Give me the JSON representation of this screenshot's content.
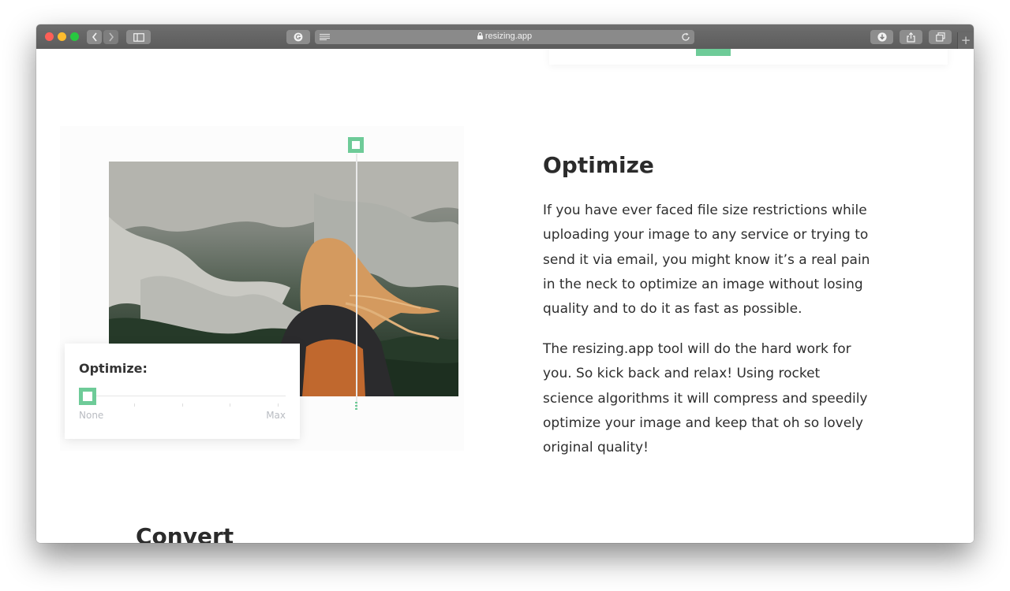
{
  "browser": {
    "url": "resizing.app"
  },
  "illustration": {
    "panel_label": "Optimize:",
    "slider": {
      "min_label": "None",
      "max_label": "Max",
      "value_fraction": 0
    }
  },
  "section": {
    "title": "Optimize",
    "paragraphs": [
      "If you have ever faced file size restrictions while uploading your image to any service or trying to send it via email, you might know it’s a real pain in the neck to optimize an image without losing quality and to do it as fast as possible.",
      "The resizing.app tool will do the hard work for you. So kick back and relax! Using rocket science algorithms it will compress and speedily optimize your image and keep that oh so lovely original quality!"
    ]
  },
  "next_section": {
    "title": "Convert"
  },
  "colors": {
    "accent": "#6ecb98",
    "text": "#2e2e2e",
    "muted": "#b9bcc2"
  }
}
